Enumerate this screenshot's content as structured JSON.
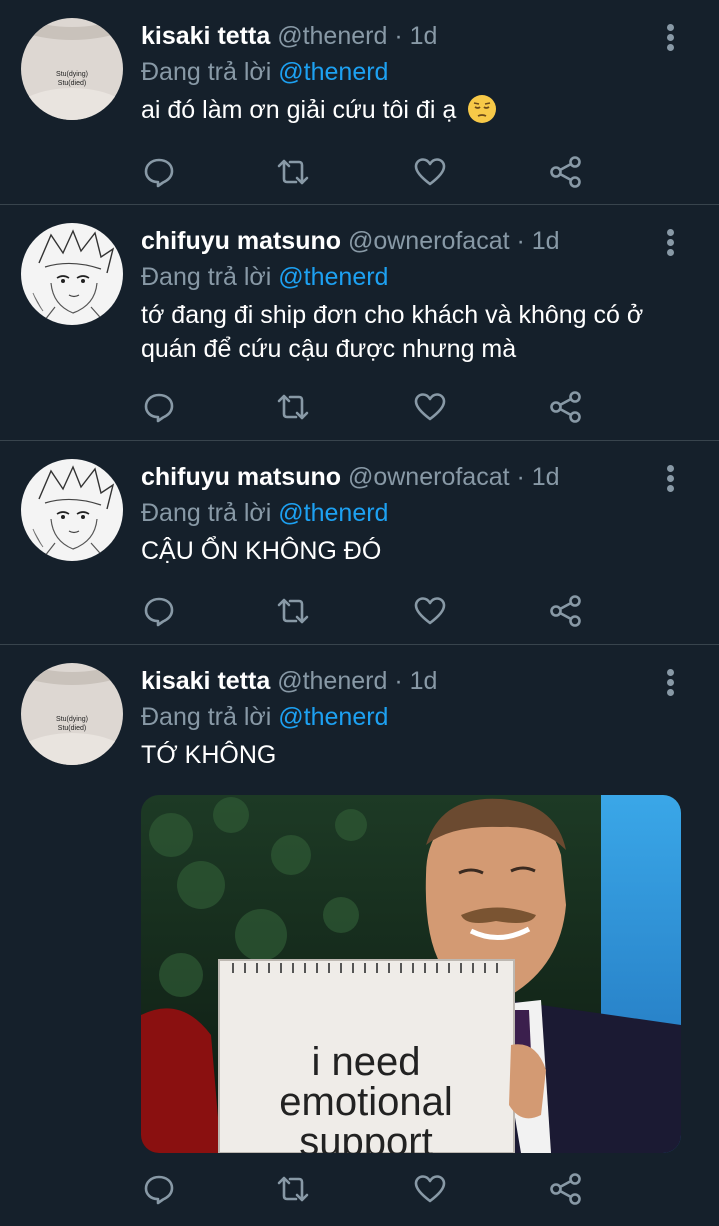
{
  "reply_prefix": "Đang trả lời",
  "colors": {
    "background": "#15202b",
    "secondary_text": "#8899a6",
    "link": "#1da1f2",
    "divider": "#38444d"
  },
  "tweets": [
    {
      "author": "kisaki tetta",
      "handle": "@thenerd",
      "separator": "·",
      "time": "1d",
      "replying_to": "@thenerd",
      "text": "ai đó làm ơn giải cứu tôi đi ạ",
      "emoji": "pensive-face",
      "avatar": {
        "type": "shirt",
        "shirt_text_1": "Stu(dying)",
        "shirt_text_2": "Stu(died)"
      }
    },
    {
      "author": "chifuyu matsuno",
      "handle": "@ownerofacat",
      "separator": "·",
      "time": "1d",
      "replying_to": "@thenerd",
      "text": "tớ đang đi ship đơn cho khách và không có ở quán để cứu cậu được nhưng mà",
      "avatar": {
        "type": "manga-sketch"
      }
    },
    {
      "author": "chifuyu matsuno",
      "handle": "@ownerofacat",
      "separator": "·",
      "time": "1d",
      "replying_to": "@thenerd",
      "text": "CẬU ỔN KHÔNG ĐÓ",
      "avatar": {
        "type": "manga-sketch"
      }
    },
    {
      "author": "kisaki tetta",
      "handle": "@thenerd",
      "separator": "·",
      "time": "1d",
      "replying_to": "@thenerd",
      "text": "TỚ KHÔNG",
      "avatar": {
        "type": "shirt",
        "shirt_text_1": "Stu(dying)",
        "shirt_text_2": "Stu(died)"
      },
      "media": {
        "type": "meme-photo",
        "sign_line_1": "i need",
        "sign_line_2": "emotional",
        "sign_line_3": "support"
      }
    }
  ],
  "action_icons": [
    "reply-icon",
    "retweet-icon",
    "like-icon",
    "share-icon"
  ]
}
